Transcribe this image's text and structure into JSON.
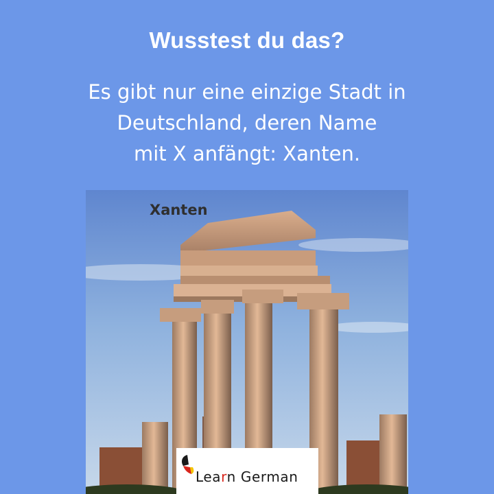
{
  "heading": "Wusstest du das?",
  "fact_lines": [
    "Es gibt nur eine einzige Stadt in",
    "Deutschland, deren Name",
    "mit X anfängt: Xanten."
  ],
  "photo": {
    "caption": "Xanten"
  },
  "logo": {
    "text_part1": "Lea",
    "text_accent": "r",
    "text_part2": "n German",
    "flag_colors": [
      "#1a1a1a",
      "#d9261c",
      "#f5c400"
    ]
  },
  "colors": {
    "background": "#6c97e8",
    "heading_text": "#ffffff"
  }
}
